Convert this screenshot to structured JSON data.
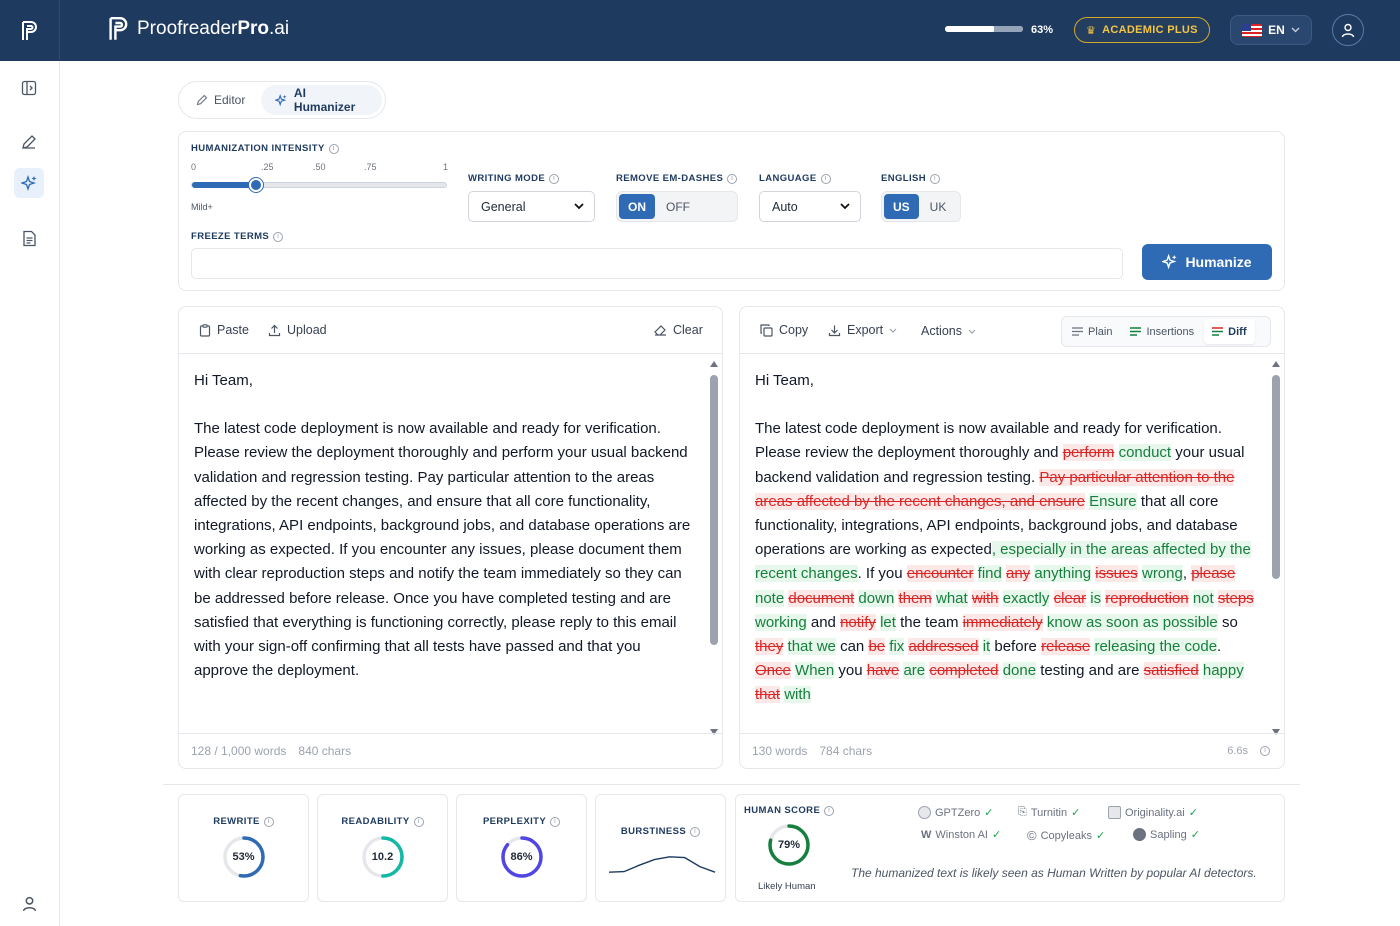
{
  "header": {
    "brand_regular": "Proofreader",
    "brand_bold": "Pro",
    "brand_suffix": ".ai",
    "usage_percent": 63,
    "usage_label": "63%",
    "plan_label": "ACADEMIC PLUS",
    "language_label": "EN"
  },
  "colors": {
    "header_bg": "#1e3a5f",
    "accent": "#2f6bb5",
    "deletion": "#dc2626",
    "insertion": "#15803d",
    "plan_gold": "#f5c542"
  },
  "rail": {
    "icons": [
      "sidebar-toggle-icon",
      "pen-icon",
      "sparkle-icon",
      "document-icon",
      "user-icon"
    ]
  },
  "mode_tabs": {
    "editor": "Editor",
    "humanizer": "AI Humanizer"
  },
  "settings": {
    "intensity_label": "HUMANIZATION INTENSITY",
    "ticks": [
      "0",
      ".25",
      ".50",
      ".75",
      "1"
    ],
    "intensity_value": 0.25,
    "intensity_name": "Mild+",
    "writing_mode_label": "WRITING MODE",
    "writing_mode_value": "General",
    "em_dash_label": "REMOVE EM-DASHES",
    "em_dash_on": "ON",
    "em_dash_off": "OFF",
    "language_label": "LANGUAGE",
    "language_value": "Auto",
    "english_label": "ENGLISH",
    "english_us": "US",
    "english_uk": "UK",
    "freeze_label": "FREEZE TERMS",
    "freeze_placeholder": "",
    "humanize_button": "Humanize"
  },
  "input_panel": {
    "paste": "Paste",
    "upload": "Upload",
    "clear": "Clear",
    "greeting": "Hi Team,",
    "body": "The latest code deployment is now available and ready for verification. Please review the deployment thoroughly and perform your usual backend validation and regression testing. Pay particular attention to the areas affected by the recent changes, and ensure that all core functionality, integrations, API endpoints, background jobs, and database operations are working as expected. If you encounter any issues, please document them with clear reproduction steps and notify the team immediately so they can be addressed before release. Once you have completed testing and are satisfied that everything is functioning correctly, please reply to this email with your sign-off confirming that all tests have passed and that you approve the deployment.",
    "word_count": "128 / 1,000 words",
    "char_count": "840 chars"
  },
  "output_panel": {
    "copy": "Copy",
    "export": "Export",
    "actions": "Actions",
    "view_plain": "Plain",
    "view_insertions": "Insertions",
    "view_diff": "Diff",
    "greeting": "Hi Team,",
    "word_count": "130 words",
    "char_count": "784 chars",
    "elapsed": "6.6s",
    "diff": [
      {
        "t": " The latest code deployment is now available and ready for verification. Please review the deployment thoroughly and ",
        "k": "eq"
      },
      {
        "t": "perform",
        "k": "del"
      },
      {
        "t": " ",
        "k": "eq"
      },
      {
        "t": "conduct",
        "k": "ins"
      },
      {
        "t": " your usual backend validation and regression testing. ",
        "k": "eq"
      },
      {
        "t": "Pay particular attention to the areas affected by the recent changes, and ensure",
        "k": "del"
      },
      {
        "t": " ",
        "k": "eq"
      },
      {
        "t": "Ensure",
        "k": "ins"
      },
      {
        "t": " that all core functionality, integrations, API endpoints, background jobs, and database operations are working as expected",
        "k": "eq"
      },
      {
        "t": ", especially in the areas affected by the recent changes",
        "k": "ins"
      },
      {
        "t": ". If you ",
        "k": "eq"
      },
      {
        "t": "encounter",
        "k": "del"
      },
      {
        "t": " ",
        "k": "eq"
      },
      {
        "t": "find",
        "k": "ins"
      },
      {
        "t": " ",
        "k": "eq"
      },
      {
        "t": "any",
        "k": "del"
      },
      {
        "t": " ",
        "k": "eq"
      },
      {
        "t": "anything",
        "k": "ins"
      },
      {
        "t": " ",
        "k": "eq"
      },
      {
        "t": "issues",
        "k": "del"
      },
      {
        "t": " ",
        "k": "eq"
      },
      {
        "t": "wrong",
        "k": "ins"
      },
      {
        "t": ", ",
        "k": "eq"
      },
      {
        "t": "please",
        "k": "del"
      },
      {
        "t": " ",
        "k": "eq"
      },
      {
        "t": "note",
        "k": "ins"
      },
      {
        "t": " ",
        "k": "eq"
      },
      {
        "t": "document",
        "k": "del"
      },
      {
        "t": " ",
        "k": "eq"
      },
      {
        "t": "down",
        "k": "ins"
      },
      {
        "t": " ",
        "k": "eq"
      },
      {
        "t": "them",
        "k": "del"
      },
      {
        "t": " ",
        "k": "eq"
      },
      {
        "t": "what",
        "k": "ins"
      },
      {
        "t": " ",
        "k": "eq"
      },
      {
        "t": "with",
        "k": "del"
      },
      {
        "t": " ",
        "k": "eq"
      },
      {
        "t": "exactly",
        "k": "ins"
      },
      {
        "t": " ",
        "k": "eq"
      },
      {
        "t": "clear",
        "k": "del"
      },
      {
        "t": " ",
        "k": "eq"
      },
      {
        "t": "is",
        "k": "ins"
      },
      {
        "t": " ",
        "k": "eq"
      },
      {
        "t": "reproduction",
        "k": "del"
      },
      {
        "t": " ",
        "k": "eq"
      },
      {
        "t": "not",
        "k": "ins"
      },
      {
        "t": " ",
        "k": "eq"
      },
      {
        "t": "steps",
        "k": "del"
      },
      {
        "t": " ",
        "k": "eq"
      },
      {
        "t": "working",
        "k": "ins"
      },
      {
        "t": " and ",
        "k": "eq"
      },
      {
        "t": "notify",
        "k": "del"
      },
      {
        "t": " ",
        "k": "eq"
      },
      {
        "t": "let",
        "k": "ins"
      },
      {
        "t": " the team ",
        "k": "eq"
      },
      {
        "t": "immediately",
        "k": "del"
      },
      {
        "t": " ",
        "k": "eq"
      },
      {
        "t": "know as soon as possible",
        "k": "ins"
      },
      {
        "t": " so ",
        "k": "eq"
      },
      {
        "t": "they",
        "k": "del"
      },
      {
        "t": " ",
        "k": "eq"
      },
      {
        "t": "that we",
        "k": "ins"
      },
      {
        "t": " can ",
        "k": "eq"
      },
      {
        "t": "be",
        "k": "del"
      },
      {
        "t": " ",
        "k": "eq"
      },
      {
        "t": "fix",
        "k": "ins"
      },
      {
        "t": " ",
        "k": "eq"
      },
      {
        "t": "addressed",
        "k": "del"
      },
      {
        "t": " ",
        "k": "eq"
      },
      {
        "t": "it",
        "k": "ins"
      },
      {
        "t": " before ",
        "k": "eq"
      },
      {
        "t": "release",
        "k": "del"
      },
      {
        "t": " ",
        "k": "eq"
      },
      {
        "t": "releasing the code",
        "k": "ins"
      },
      {
        "t": ". ",
        "k": "eq"
      },
      {
        "t": "Once",
        "k": "del"
      },
      {
        "t": " ",
        "k": "eq"
      },
      {
        "t": "When",
        "k": "ins"
      },
      {
        "t": " you ",
        "k": "eq"
      },
      {
        "t": "have",
        "k": "del"
      },
      {
        "t": " ",
        "k": "eq"
      },
      {
        "t": "are",
        "k": "ins"
      },
      {
        "t": " ",
        "k": "eq"
      },
      {
        "t": "completed",
        "k": "del"
      },
      {
        "t": " ",
        "k": "eq"
      },
      {
        "t": "done",
        "k": "ins"
      },
      {
        "t": " testing and are ",
        "k": "eq"
      },
      {
        "t": "satisfied",
        "k": "del"
      },
      {
        "t": " ",
        "k": "eq"
      },
      {
        "t": "happy",
        "k": "ins"
      },
      {
        "t": " ",
        "k": "eq"
      },
      {
        "t": "that",
        "k": "del"
      },
      {
        "t": " ",
        "k": "eq"
      },
      {
        "t": "with",
        "k": "ins"
      }
    ]
  },
  "metrics": {
    "rewrite_label": "REWRITE",
    "rewrite_value": "53%",
    "rewrite_fraction": 0.53,
    "rewrite_color": "#2f6bb5",
    "readability_label": "READABILITY",
    "readability_value": "10.2",
    "readability_fraction": 0.5,
    "readability_color": "#14b8a6",
    "perplexity_label": "PERPLEXITY",
    "perplexity_value": "86%",
    "perplexity_fraction": 0.86,
    "perplexity_color": "#4f46e5",
    "burstiness_label": "BURSTINESS",
    "burstiness_series": [
      0.1,
      0.12,
      0.35,
      0.55,
      0.65,
      0.62,
      0.3,
      0.1
    ]
  },
  "human_score": {
    "label": "HUMAN SCORE",
    "value": "79%",
    "fraction": 0.79,
    "verdict_short": "Likely Human",
    "detectors": [
      "GPTZero",
      "Turnitin",
      "Originality.ai",
      "Winston AI",
      "Copyleaks",
      "Sapling"
    ],
    "verdict_text": "The humanized text is likely seen as Human Written by popular AI detectors."
  }
}
